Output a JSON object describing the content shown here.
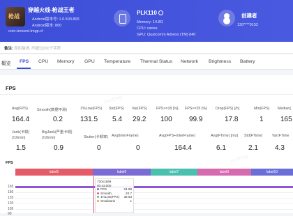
{
  "app": {
    "name": "穿越火线-枪战王者",
    "icon_text": "枪战",
    "android_version_line": "Android版本号: 1.0.500.800",
    "android_code_line": "Android版本: 800",
    "package": "com.tencent.tmgp.cf"
  },
  "device": {
    "model": "PLK110",
    "memory": "Memory: 14.8G",
    "cpu": "CPU: canoe",
    "gpu": "GPU: Qualcomm Adreno (TM) 840"
  },
  "creator": {
    "label": "创建者",
    "id": "130****9152"
  },
  "note": {
    "label": "备注:",
    "placeholder": "添加描述, 不超过200个字符"
  },
  "tabs": [
    "概览",
    "FPS",
    "CPU",
    "Memory",
    "GPU",
    "Temperature",
    "Thermal Status",
    "Network",
    "Brightness",
    "Battery"
  ],
  "active_tab": "FPS",
  "panel_title": "FPS",
  "metrics_row1": [
    {
      "label": "Avg(FPS)",
      "value": "164.4"
    },
    {
      "label": "Smooth(数据平滑)",
      "value": "0.2"
    },
    {
      "label": "1%Low(FPS)",
      "value": "131.5"
    },
    {
      "label": "Std(FPS)",
      "value": "5.4"
    },
    {
      "label": "Var(FPS)",
      "value": "29.2"
    },
    {
      "label": "FPS>=18 [%]",
      "value": "100"
    },
    {
      "label": "FPS>=25 [%]",
      "value": "99.9"
    },
    {
      "label": "Drop(FPS) [/h]",
      "value": "17.8"
    },
    {
      "label": "Min(FPS)",
      "value": "1"
    },
    {
      "label": "Median(",
      "value": "165"
    }
  ],
  "metrics_row2": [
    {
      "label": "Jank(卡顿)\n(/10min)",
      "value": "1.5"
    },
    {
      "label": "BigJank(严重卡顿)\n(/10min)",
      "value": "0.9"
    },
    {
      "label": "Stutter(卡顿率)",
      "value": "0"
    },
    {
      "label": "Avg(InterFrame)",
      "value": "0"
    },
    {
      "label": "Avg(FPS+InterFrame)",
      "value": "164.4"
    },
    {
      "label": "Avg(FTime) [ms]",
      "value": "6.1"
    },
    {
      "label": "Std(FTime)",
      "value": "2.1"
    },
    {
      "label": "Var(FTime",
      "value": "4.3"
    }
  ],
  "chart": {
    "title": "FPS",
    "segments": [
      {
        "label": "label5",
        "color": "#e45a67"
      },
      {
        "label": "label6",
        "color": "#7b6bd4"
      },
      {
        "label": "label7",
        "color": "#4cc0b0"
      },
      {
        "label": "label9",
        "color": "#d66ab0"
      },
      {
        "label": "label10",
        "color": "#6a6fd8"
      }
    ],
    "y_ticks": [
      "165",
      "150",
      "135",
      "120",
      "105",
      "90"
    ],
    "tooltip": {
      "resolution": "720x1569",
      "time": "00:43.000",
      "rows": [
        {
          "name": "FPS",
          "value": "24.99",
          "color": "#8f57d6"
        },
        {
          "name": "Smooth",
          "value": "20.7",
          "color": "#e45a67"
        },
        {
          "name": "1%Low(FPS)",
          "value": "36.63",
          "color": "#4cc0b0"
        },
        {
          "name": "SmallJank",
          "value": "1",
          "color": "#f0a040"
        }
      ]
    }
  },
  "chart_data": {
    "type": "line",
    "title": "FPS",
    "xlabel": "",
    "ylabel": "",
    "y_ticks": [
      165,
      150,
      135,
      120,
      105,
      90
    ],
    "series": [
      {
        "name": "FPS",
        "values": [
          165,
          165,
          165,
          165,
          25,
          165,
          165,
          165,
          165,
          165
        ]
      }
    ]
  },
  "watermark": "PerfDog"
}
